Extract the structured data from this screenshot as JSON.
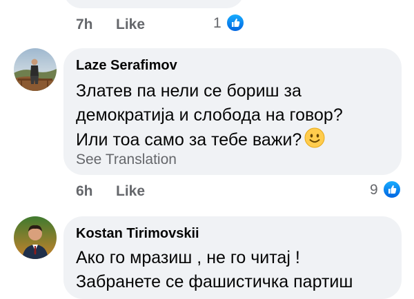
{
  "comments": [
    {
      "time": "7h",
      "like_label": "Like",
      "reaction_count": "1"
    },
    {
      "author": "Laze Serafimov",
      "lines": [
        "Златев па нели се бориш за",
        "демократија и слобода на говор?",
        "Или тоа само за тебе важи?"
      ],
      "emoji": "smiling-face-emoji",
      "see_translation": "See Translation",
      "time": "6h",
      "like_label": "Like",
      "reaction_count": "9"
    },
    {
      "author": "Kostan Tirimovskii",
      "lines": [
        "Ако го мразиш , не го читај !",
        "Забранете се фашистичка партиш"
      ]
    }
  ],
  "icons": {
    "reaction": "like-thumb-icon",
    "avatar": "avatar"
  },
  "colors": {
    "bubble": "#f0f2f5",
    "meta_text": "#65676b",
    "like_blue": "#0165e1"
  }
}
